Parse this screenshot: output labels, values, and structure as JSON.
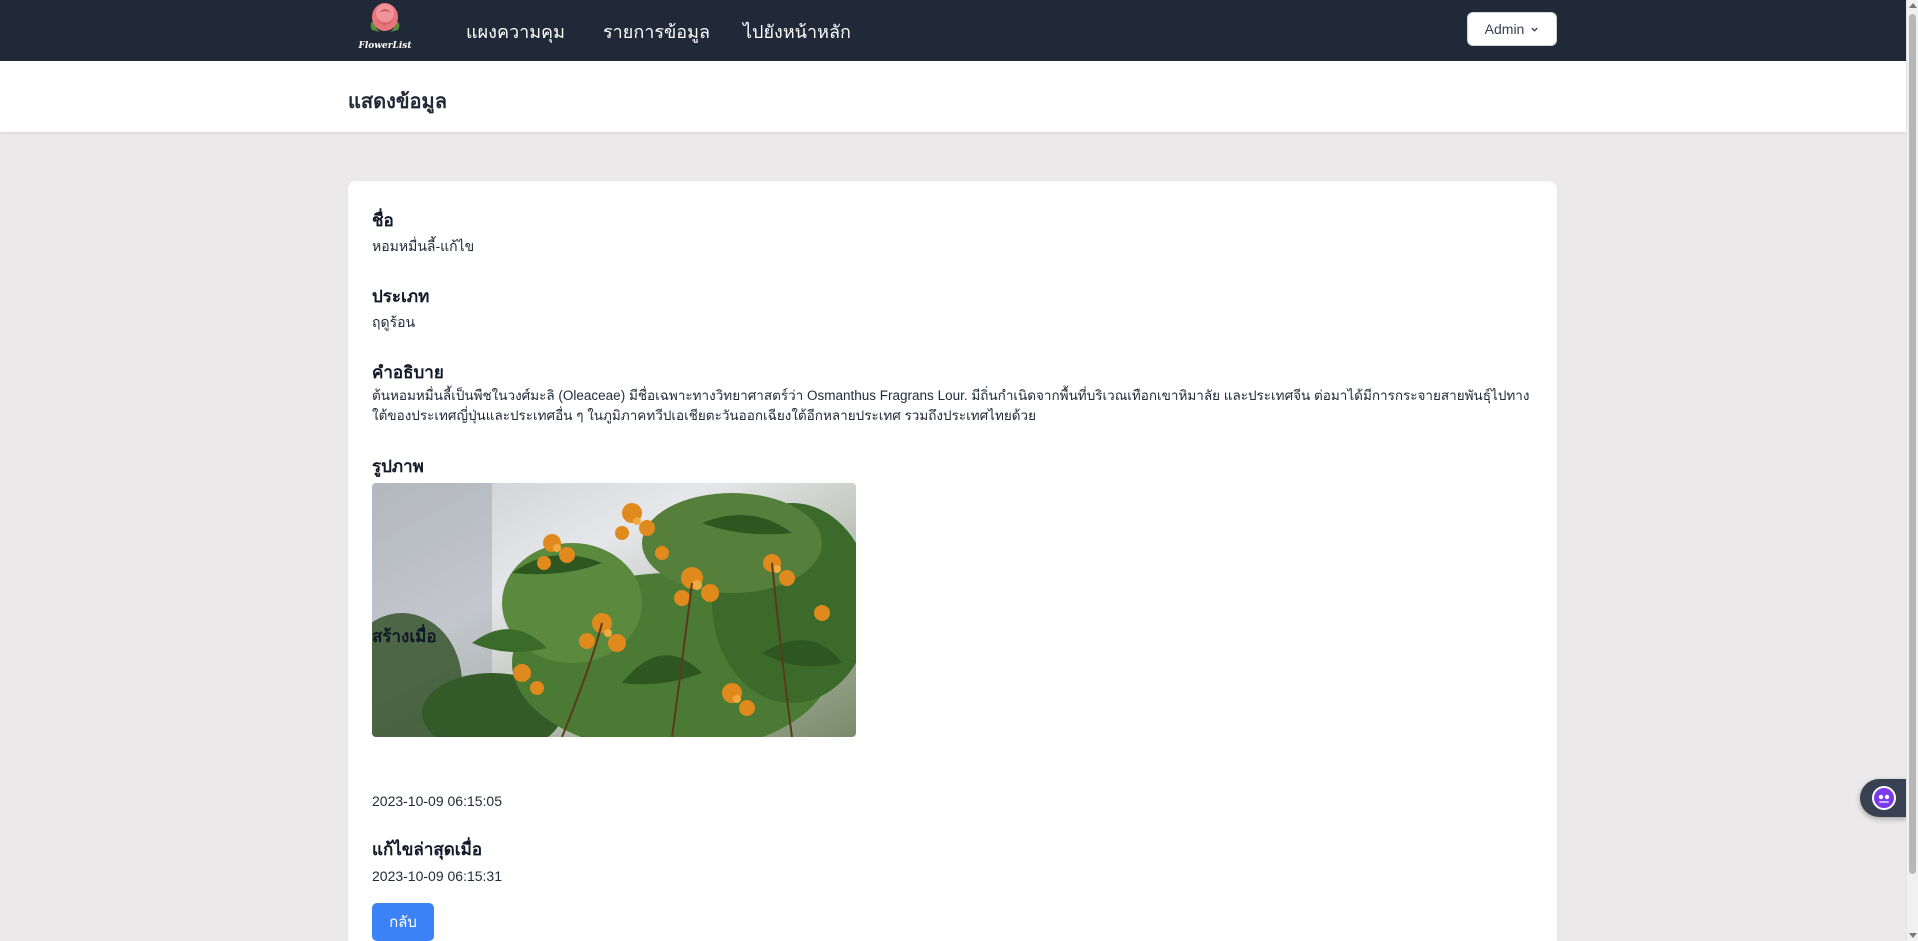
{
  "nav": {
    "logo_text": "FlowerList",
    "links": [
      "แผงความคุม",
      "รายการข้อมูล",
      "ไปยังหน้าหลัก"
    ],
    "user_menu_label": "Admin"
  },
  "page": {
    "title": "แสดงข้อมูล"
  },
  "detail": {
    "name_label": "ชื่อ",
    "name_value": "หอมหมื่นลี้-แก้ไข",
    "type_label": "ประเภท",
    "type_value": "ฤดูร้อน",
    "description_label": "คำอธิบาย",
    "description_value": "ต้นหอมหมื่นลี้เป็นพืชในวงศ์มะลิ (Oleaceae) มีชื่อเฉพาะทางวิทยาศาสตร์ว่า Osmanthus Fragrans Lour. มีถิ่นกำเนิดจากพื้นที่บริเวณเทือกเขาหิมาลัย และประเทศจีน ต่อมาได้มีการกระจายสายพันธุ์ไปทางใต้ของประเทศญี่ปุ่นและประเทศอื่น ๆ ในภูมิภาคทวีปเอเชียตะวันออกเฉียงใต้อีกหลายประเทศ รวมถึงประเทศไทยด้วย",
    "image_label": "รูปภาพ",
    "created_label": "สร้างเมื่อ",
    "created_value": "2023-10-09 06:15:05",
    "updated_label": "แก้ไขล่าสุดเมื่อ",
    "updated_value": "2023-10-09 06:15:31",
    "back_button": "กลับ"
  },
  "colors": {
    "navbar": "#1f2937",
    "page_bg": "#ebe9ea",
    "primary_button": "#3b82f6",
    "flower_orange": "#e08a1e",
    "leaf_green": "#3f6b2a"
  },
  "icons": [
    "rose-logo-icon",
    "chevron-down-icon",
    "assistant-widget-icon"
  ]
}
